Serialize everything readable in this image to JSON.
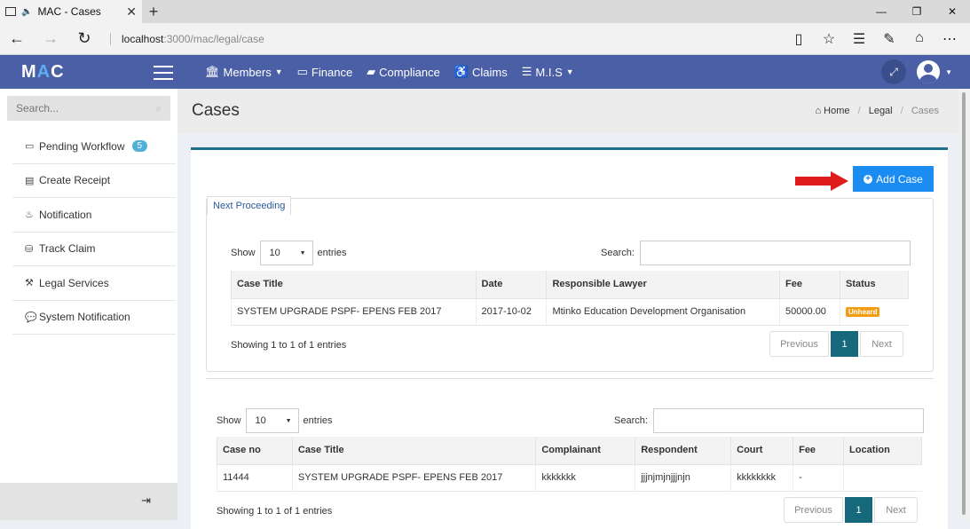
{
  "browser": {
    "tab_title": "MAC - Cases",
    "url_host": "localhost",
    "url_path": ":3000/mac/legal/case",
    "new_tab": "+",
    "minimize": "—",
    "restore": "❐",
    "close": "✕"
  },
  "header": {
    "logo_m": "M",
    "logo_a": "A",
    "logo_c": "C",
    "menu": [
      {
        "label": "Members",
        "has_caret": true
      },
      {
        "label": "Finance",
        "has_caret": false
      },
      {
        "label": "Compliance",
        "has_caret": false
      },
      {
        "label": "Claims",
        "has_caret": false
      },
      {
        "label": "M.I.S",
        "has_caret": true
      }
    ]
  },
  "sidebar": {
    "search_placeholder": "Search...",
    "items": [
      {
        "label": "Pending Workflow",
        "icon": "inbox-icon",
        "badge": "5"
      },
      {
        "label": "Create Receipt",
        "icon": "receipt-icon"
      },
      {
        "label": "Notification",
        "icon": "bell-icon"
      },
      {
        "label": "Track Claim",
        "icon": "track-icon"
      },
      {
        "label": "Legal Services",
        "icon": "gavel-icon"
      },
      {
        "label": "System Notification",
        "icon": "comments-icon"
      }
    ]
  },
  "page": {
    "title": "Cases",
    "breadcrumb": [
      "Home",
      "Legal",
      "Cases"
    ],
    "add_case_label": "Add Case"
  },
  "next_proceeding": {
    "tab_label": "Next Proceeding",
    "show_label": "Show",
    "entries_value": "10",
    "entries_label": "entries",
    "search_label": "Search:",
    "columns": [
      "Case Title",
      "Date",
      "Responsible Lawyer",
      "Fee",
      "Status"
    ],
    "rows": [
      {
        "title": "SYSTEM UPGRADE PSPF- EPENS FEB 2017",
        "date": "2017-10-02",
        "lawyer": "Mtinko Education Development Organisation",
        "fee": "50000.00",
        "status": "Unheard"
      }
    ],
    "info": "Showing 1 to 1 of 1 entries",
    "prev": "Previous",
    "page": "1",
    "next": "Next"
  },
  "cases": {
    "show_label": "Show",
    "entries_value": "10",
    "entries_label": "entries",
    "search_label": "Search:",
    "columns": [
      "Case no",
      "Case Title",
      "Complainant",
      "Respondent",
      "Court",
      "Fee",
      "Location"
    ],
    "rows": [
      {
        "case_no": "11444",
        "title": "SYSTEM UPGRADE PSPF- EPENS FEB 2017",
        "complainant": "kkkkkkk",
        "respondent": "jjjnjmjnjjjnjn",
        "court": "kkkkkkkk",
        "fee": "-",
        "location": ""
      }
    ],
    "info": "Showing 1 to 1 of 1 entries",
    "prev": "Previous",
    "page": "1",
    "next": "Next"
  },
  "colors": {
    "header": "#4a5fa5",
    "primary_button": "#1a8cf2",
    "pager_active": "#16697a",
    "status_unheard": "#f39c12",
    "badge": "#4fb0d8",
    "arrow": "#e01b1b"
  }
}
